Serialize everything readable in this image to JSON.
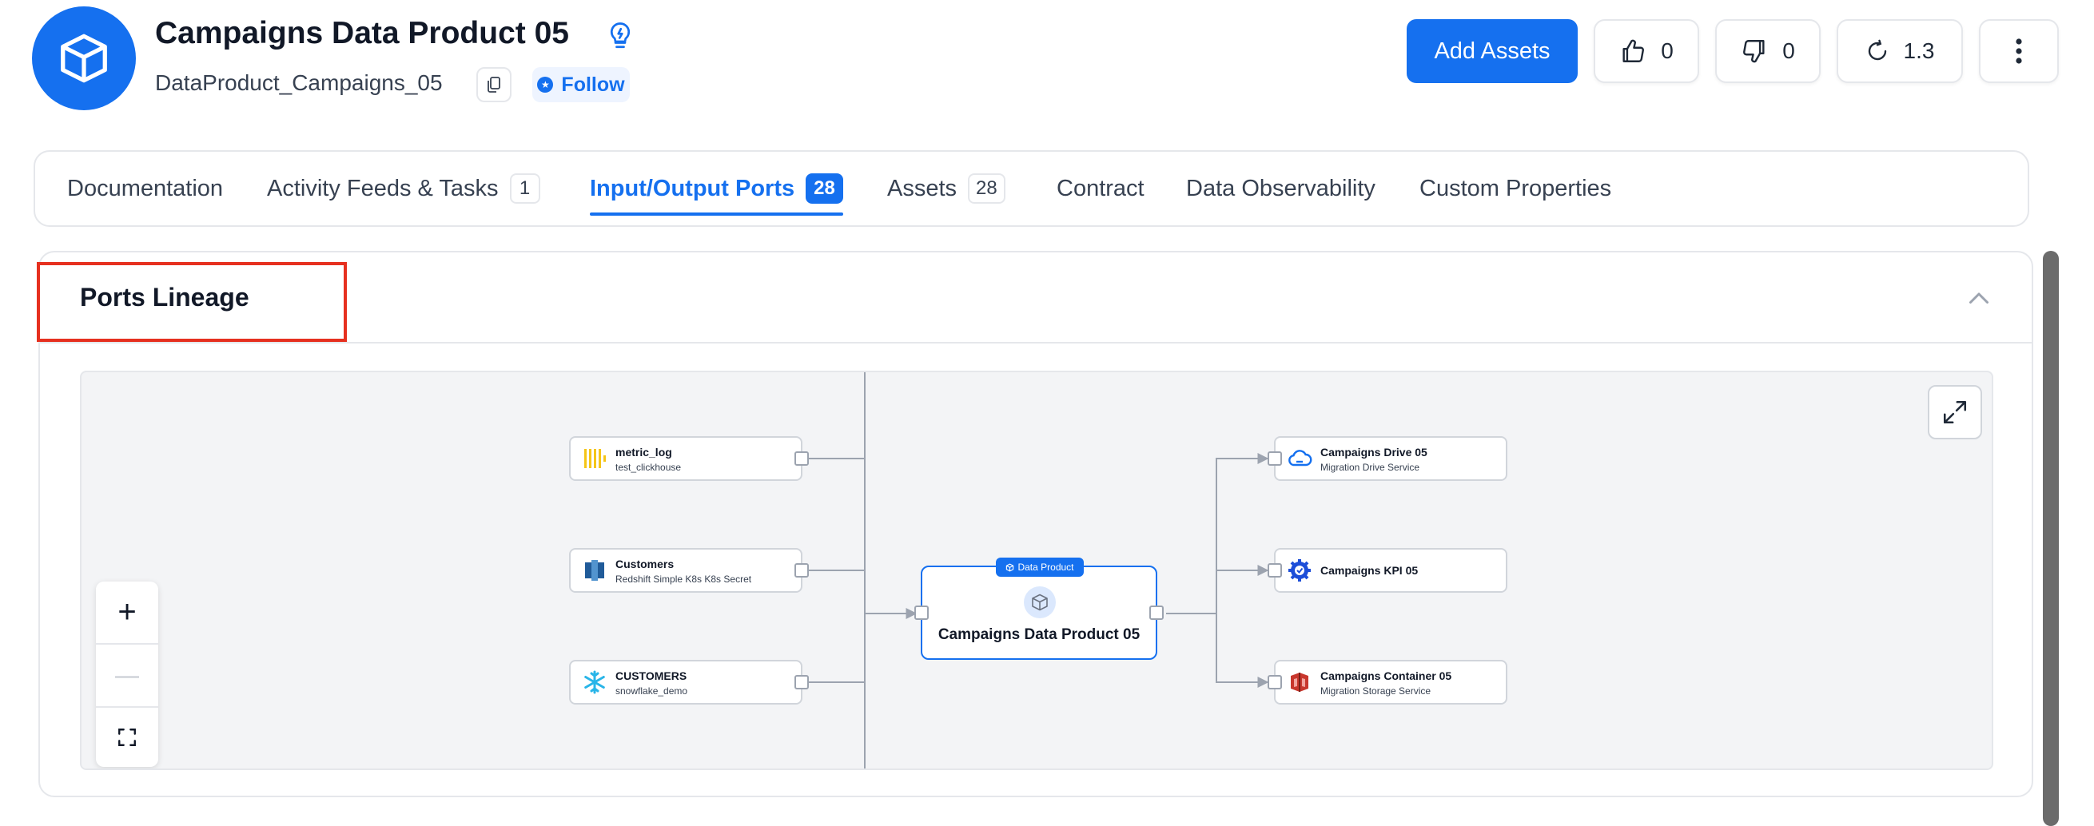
{
  "header": {
    "title": "Campaigns Data Product 05",
    "fqn": "DataProduct_Campaigns_05",
    "follow_label": "Follow",
    "add_assets_label": "Add Assets",
    "likes": "0",
    "dislikes": "0",
    "version": "1.3",
    "avatar_icon": "cube-icon",
    "accent_color": "#1570ef"
  },
  "tabs": [
    {
      "label": "Documentation"
    },
    {
      "label": "Activity Feeds & Tasks",
      "count": "1"
    },
    {
      "label": "Input/Output Ports",
      "count": "28",
      "active": true
    },
    {
      "label": "Assets",
      "count": "28"
    },
    {
      "label": "Contract"
    },
    {
      "label": "Data Observability"
    },
    {
      "label": "Custom Properties"
    }
  ],
  "ports_lineage": {
    "title": "Ports Lineage",
    "center": {
      "tag": "Data Product",
      "name": "Campaigns Data Product 05"
    },
    "inputs": [
      {
        "name": "metric_log",
        "service": "test_clickhouse",
        "icon": "clickhouse-icon"
      },
      {
        "name": "Customers",
        "service": "Redshift Simple K8s K8s Secret",
        "icon": "redshift-icon"
      },
      {
        "name": "CUSTOMERS",
        "service": "snowflake_demo",
        "icon": "snowflake-icon"
      }
    ],
    "outputs": [
      {
        "name": "Campaigns Drive 05",
        "service": "Migration Drive Service",
        "icon": "drive-icon"
      },
      {
        "name": "Campaigns KPI 05",
        "service": "",
        "icon": "kpi-icon"
      },
      {
        "name": "Campaigns Container 05",
        "service": "Migration Storage Service",
        "icon": "container-icon"
      }
    ],
    "zoom_controls": {
      "zoom_in": "+",
      "zoom_out": "—"
    }
  }
}
